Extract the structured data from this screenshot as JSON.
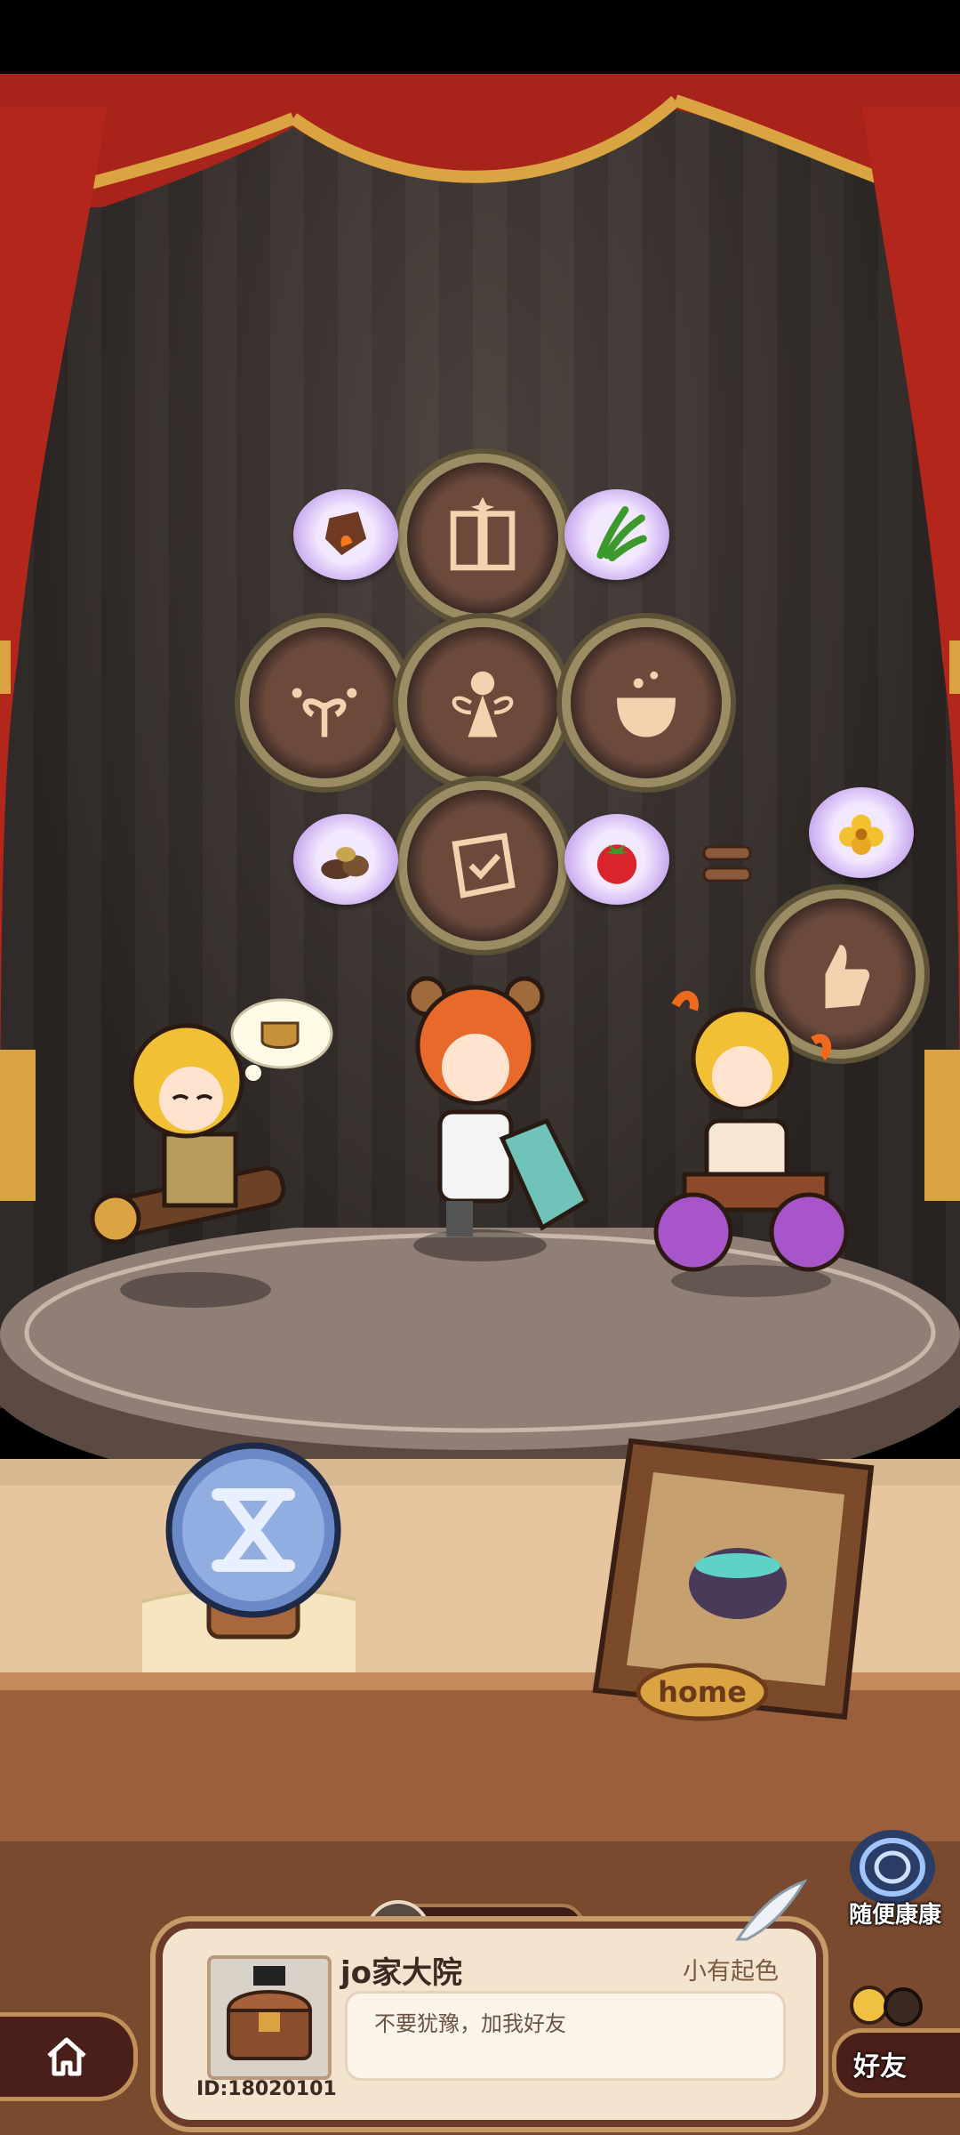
{
  "scene": {
    "name": "theater-stage"
  },
  "workbench": {
    "badges": [
      "book-badge",
      "sprout-badge",
      "fairy-badge",
      "cauldron-badge",
      "scroll-badge",
      "hand-badge"
    ],
    "ingredients": [
      "ore-icon",
      "leek-icon",
      "stones-icon",
      "tomato-icon",
      "flower-icon"
    ]
  },
  "characters": [
    "blonde-explorer",
    "red-haired-bear-ear-girl",
    "flame-haired-wheelchair-boy"
  ],
  "props": {
    "orb_icon": "hourglass-icon",
    "frame_label": "home"
  },
  "like_bar": {
    "count": "0"
  },
  "profile": {
    "name": "jo家大院",
    "rank_title": "小有起色",
    "motto": "不要犹豫，加我好友",
    "id_text": "ID:18020101"
  },
  "side_buttons": {
    "random_visit_label": "随便康康",
    "friends_label": "好友"
  },
  "colors": {
    "curtain": "#b3261c",
    "gold": "#d9a441",
    "card_border": "#6b3a2a"
  }
}
